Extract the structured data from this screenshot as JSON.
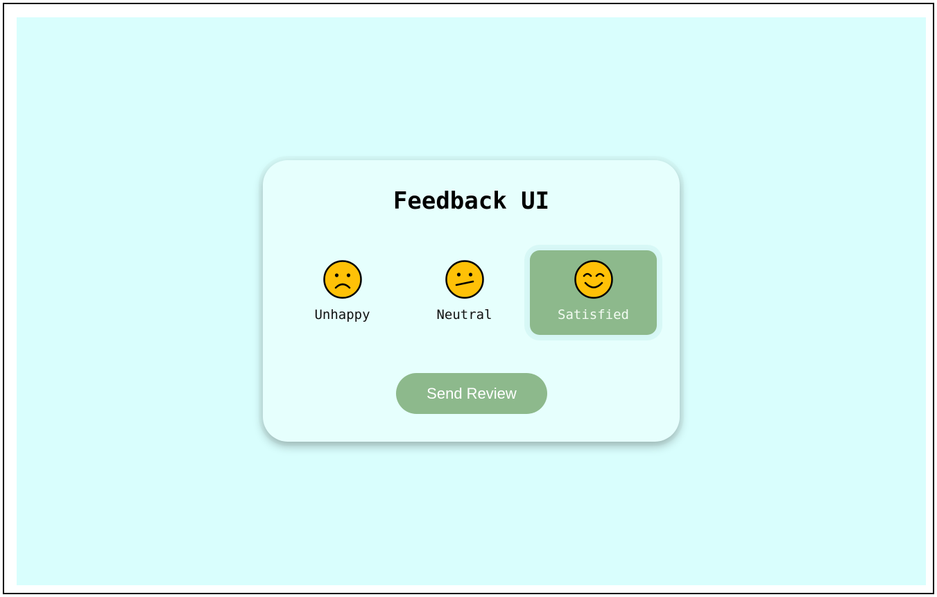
{
  "feedback_card": {
    "title": "Feedback UI",
    "ratings": [
      {
        "label": "Unhappy",
        "icon": "frowning-face-icon",
        "selected": false
      },
      {
        "label": "Neutral",
        "icon": "neutral-face-icon",
        "selected": false
      },
      {
        "label": "Satisfied",
        "icon": "smiling-face-icon",
        "selected": true
      }
    ],
    "send_button_label": "Send Review"
  },
  "colors": {
    "page_background": "#d9fefd",
    "card_background": "#e6fffd",
    "accent": "#8db98c",
    "emoji_fill": "#ffc107"
  }
}
